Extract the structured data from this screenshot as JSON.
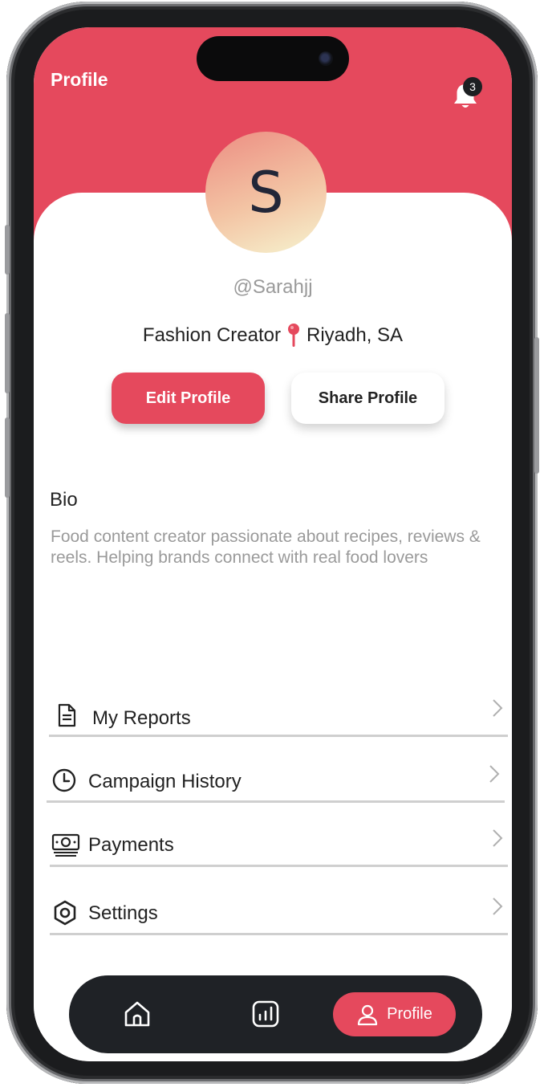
{
  "header": {
    "title": "Profile",
    "notification_count": "3",
    "bg_color": "#e5495d"
  },
  "profile": {
    "avatar_initial": "S",
    "handle": "@Sarahjj",
    "role": "Fashion Creator",
    "location": "Riyadh, SA"
  },
  "actions": {
    "edit_label": "Edit Profile",
    "share_label": "Share Profile"
  },
  "bio": {
    "title": "Bio",
    "text": "Food content creator passionate about recipes, reviews & reels. Helping brands connect with real food lovers"
  },
  "menu": {
    "items": [
      {
        "label": "My Reports",
        "icon": "document-icon"
      },
      {
        "label": "Campaign History",
        "icon": "clock-icon"
      },
      {
        "label": "Payments",
        "icon": "cash-icon"
      },
      {
        "label": "Settings",
        "icon": "hexagon-settings-icon"
      }
    ]
  },
  "nav": {
    "active_label": "Profile",
    "items": [
      "home-icon",
      "chart-icon",
      "user-icon"
    ]
  }
}
